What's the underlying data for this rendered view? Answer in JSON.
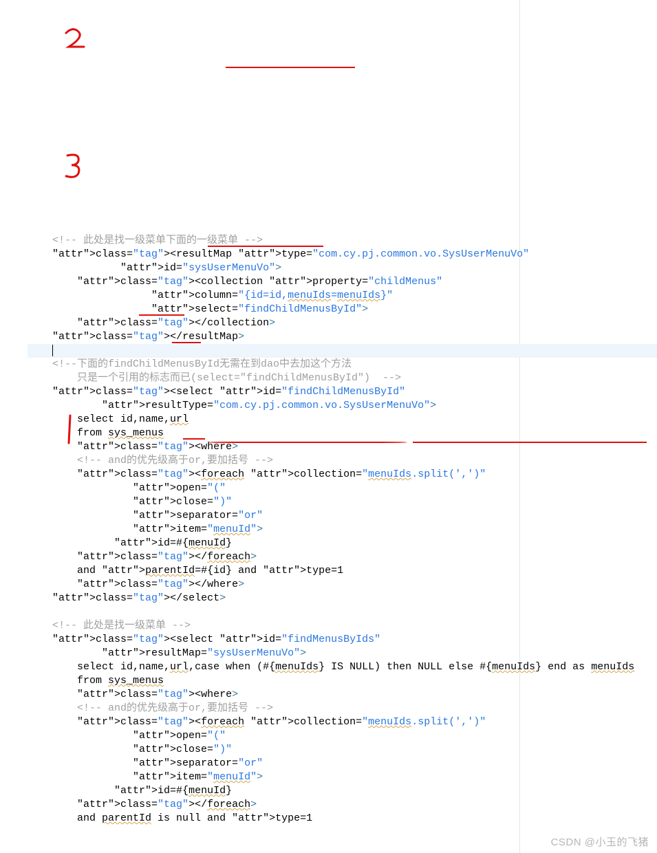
{
  "watermark": "CSDN @小玉的飞猪",
  "annotations": {
    "mark2": "2",
    "mark3": "3",
    "mark1": "1"
  },
  "lines": [
    "    <!-- 此处是找一级菜单下面的一级菜单 -->",
    "    <resultMap type=\"com.cy.pj.common.vo.SysUserMenuVo\"",
    "               id=\"sysUserMenuVo\">",
    "        <collection property=\"childMenus\"",
    "                    column=\"{id=id,menuIds=menuIds}\"",
    "                    select=\"findChildMenusById\">",
    "        </collection>",
    "    </resultMap>",
    "    |",
    "    <!--下面的findChildMenusById无需在到dao中去加这个方法",
    "        只是一个引用的标志而已(select=\"findChildMenusById\")  -->",
    "    <select id=\"findChildMenusById\"",
    "            resultType=\"com.cy.pj.common.vo.SysUserMenuVo\">",
    "        select id,name,url",
    "        from sys_menus",
    "        <where>",
    "        <!-- and的优先级高于or,要加括号 -->",
    "        <foreach collection=\"menuIds.split(',')\"",
    "                 open=\"(\"",
    "                 close=\")\"",
    "                 separator=\"or\"",
    "                 item=\"menuId\">",
    "              id=#{menuId}",
    "        </foreach>",
    "        and parentId=#{id} and type=1",
    "        </where>",
    "    </select>",
    "",
    "    <!-- 此处是找一级菜单 -->",
    "    <select id=\"findMenusByIds\"",
    "            resultMap=\"sysUserMenuVo\">",
    "        select id,name,url,case when (#{menuIds} IS NULL) then NULL else #{menuIds} end as menuIds",
    "        from sys_menus",
    "        <where>",
    "        <!-- and的优先级高于or,要加括号 -->",
    "        <foreach collection=\"menuIds.split(',')\"",
    "                 open=\"(\"",
    "                 close=\")\"",
    "                 separator=\"or\"",
    "                 item=\"menuId\">",
    "              id=#{menuId}",
    "        </foreach>",
    "        and parentId is null and type=1"
  ]
}
